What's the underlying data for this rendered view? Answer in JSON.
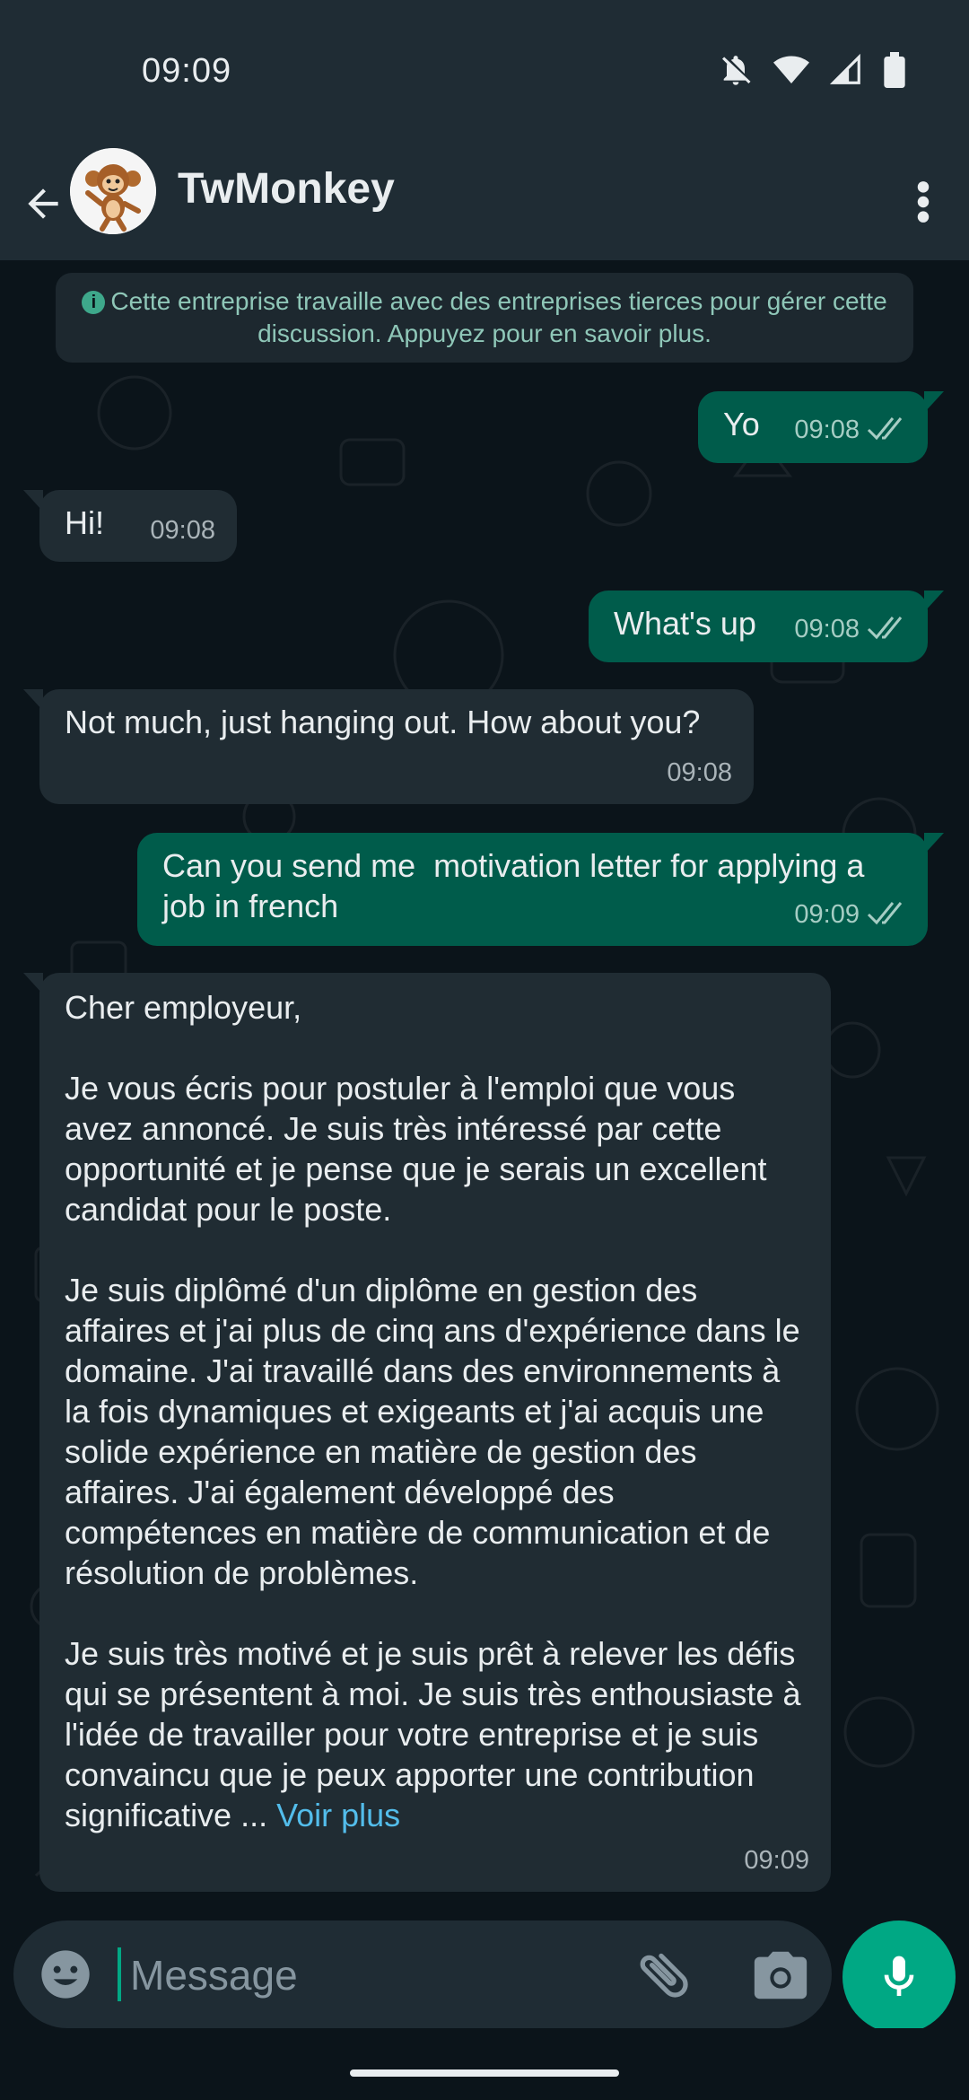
{
  "status_bar": {
    "time": "09:09",
    "icons": [
      "notifications-off-icon",
      "wifi-icon",
      "signal-icon",
      "battery-icon"
    ]
  },
  "header": {
    "contact_name": "TwMonkey",
    "avatar": "monkey-avatar",
    "back_icon": "arrow-back-icon",
    "menu_icon": "more-vert-icon"
  },
  "chat": {
    "notice": "Cette entreprise travaille avec des entreprises tierces pour gérer cette discussion. Appuyez pour en savoir plus.",
    "messages": [
      {
        "direction": "out",
        "text": "Yo",
        "time": "09:08",
        "status": "read"
      },
      {
        "direction": "in",
        "text": "Hi!",
        "time": "09:08"
      },
      {
        "direction": "out",
        "text": "What's up",
        "time": "09:08",
        "status": "read"
      },
      {
        "direction": "in",
        "text": "Not much, just hanging out. How about you?",
        "time": "09:08"
      },
      {
        "direction": "out",
        "text": "Can you send me  motivation letter for applying a job in french",
        "time": "09:09",
        "status": "read"
      },
      {
        "direction": "in",
        "paragraphs": [
          "Cher employeur,",
          "Je vous écris pour postuler à l'emploi que vous avez annoncé. Je suis très intéressé par cette opportunité et je pense que je serais un excellent candidat pour le poste.",
          "Je suis diplômé d'un diplôme en gestion des affaires et j'ai plus de cinq ans d'expérience dans le domaine. J'ai travaillé dans des environnements à la fois dynamiques et exigeants et j'ai acquis une solide expérience en matière de gestion des affaires. J'ai également développé des compétences en matière de communication et de résolution de problèmes.",
          "Je suis très motivé et je suis prêt à relever les défis qui se présentent à moi. Je suis très enthousiaste à l'idée de travailler pour votre entreprise et je suis convaincu que je peux apporter une contribution significative ..."
        ],
        "read_more": "Voir plus",
        "time": "09:09"
      }
    ]
  },
  "input": {
    "placeholder": "Message",
    "value": ""
  },
  "colors": {
    "header_bg": "#1f2c34",
    "chat_bg": "#0b141a",
    "outgoing_bubble": "#005c4b",
    "incoming_bubble": "#202c33",
    "accent": "#00a884",
    "link": "#53bdeb"
  }
}
